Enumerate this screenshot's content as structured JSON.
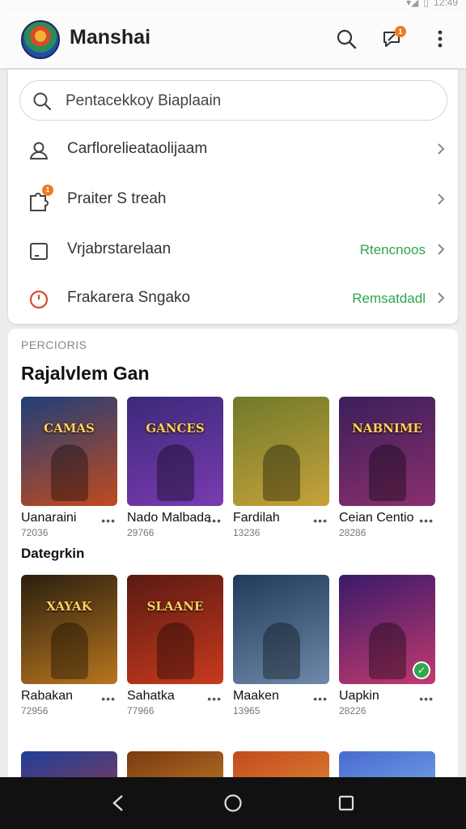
{
  "status_bar": {
    "time": "12:49"
  },
  "app": {
    "title": "Manshai"
  },
  "header": {
    "notification_count": "1"
  },
  "search": {
    "placeholder": "Pentacekkoy Biaplaain"
  },
  "menu": [
    {
      "label": "Carflorelieataolijaam",
      "value": "",
      "icon": "user-icon"
    },
    {
      "label": "Praiter S treah",
      "value": "",
      "icon": "puzzle-icon",
      "badge": "1"
    },
    {
      "label": "Vrjabrstarelaan",
      "value": "Rtencnoos",
      "icon": "square-icon"
    },
    {
      "label": "Frakarera Sngako",
      "value": "Remsatdadl",
      "icon": "clock-icon"
    }
  ],
  "section": {
    "eyebrow": "PERCIORIS",
    "title": "Rajalvlem Gan"
  },
  "games_row1": [
    {
      "name": "Uanaraini",
      "count": "72036",
      "art_title": "CAMAS",
      "colors": [
        "#1f3f7a",
        "#c24a1e"
      ]
    },
    {
      "name": "Nado Malbada",
      "count": "29766",
      "art_title": "GANCES",
      "colors": [
        "#3b2a7a",
        "#7a3bb0"
      ]
    },
    {
      "name": "Fardilah",
      "count": "13236",
      "art_title": "",
      "colors": [
        "#6f7a2a",
        "#c7a23a"
      ]
    },
    {
      "name": "Ceian Centio",
      "count": "28286",
      "art_title": "NABNIME",
      "colors": [
        "#3a1f5a",
        "#8a2f6e"
      ]
    }
  ],
  "category": {
    "label": "Dategrkin"
  },
  "games_row2": [
    {
      "name": "Rabakan",
      "count": "72956",
      "art_title": "XAYAK",
      "colors": [
        "#2a1f0f",
        "#b8751f"
      ]
    },
    {
      "name": "Sahatka",
      "count": "77966",
      "art_title": "SLAANE",
      "colors": [
        "#5a1a12",
        "#c83a1e"
      ]
    },
    {
      "name": "Maaken",
      "count": "13965",
      "art_title": "",
      "colors": [
        "#1f3a5a",
        "#6f8aa8"
      ]
    },
    {
      "name": "Uapkin",
      "count": "28226",
      "art_title": "",
      "colors": [
        "#3a1a6a",
        "#c23a6e"
      ],
      "verified": true
    }
  ],
  "games_row3": [
    {
      "colors": [
        "#1f3f9a",
        "#c23a2a"
      ]
    },
    {
      "colors": [
        "#7a3a0f",
        "#e8a23a"
      ]
    },
    {
      "colors": [
        "#c24a1e",
        "#f0b040"
      ]
    },
    {
      "colors": [
        "#4a6ad0",
        "#8ad0f0"
      ]
    }
  ]
}
